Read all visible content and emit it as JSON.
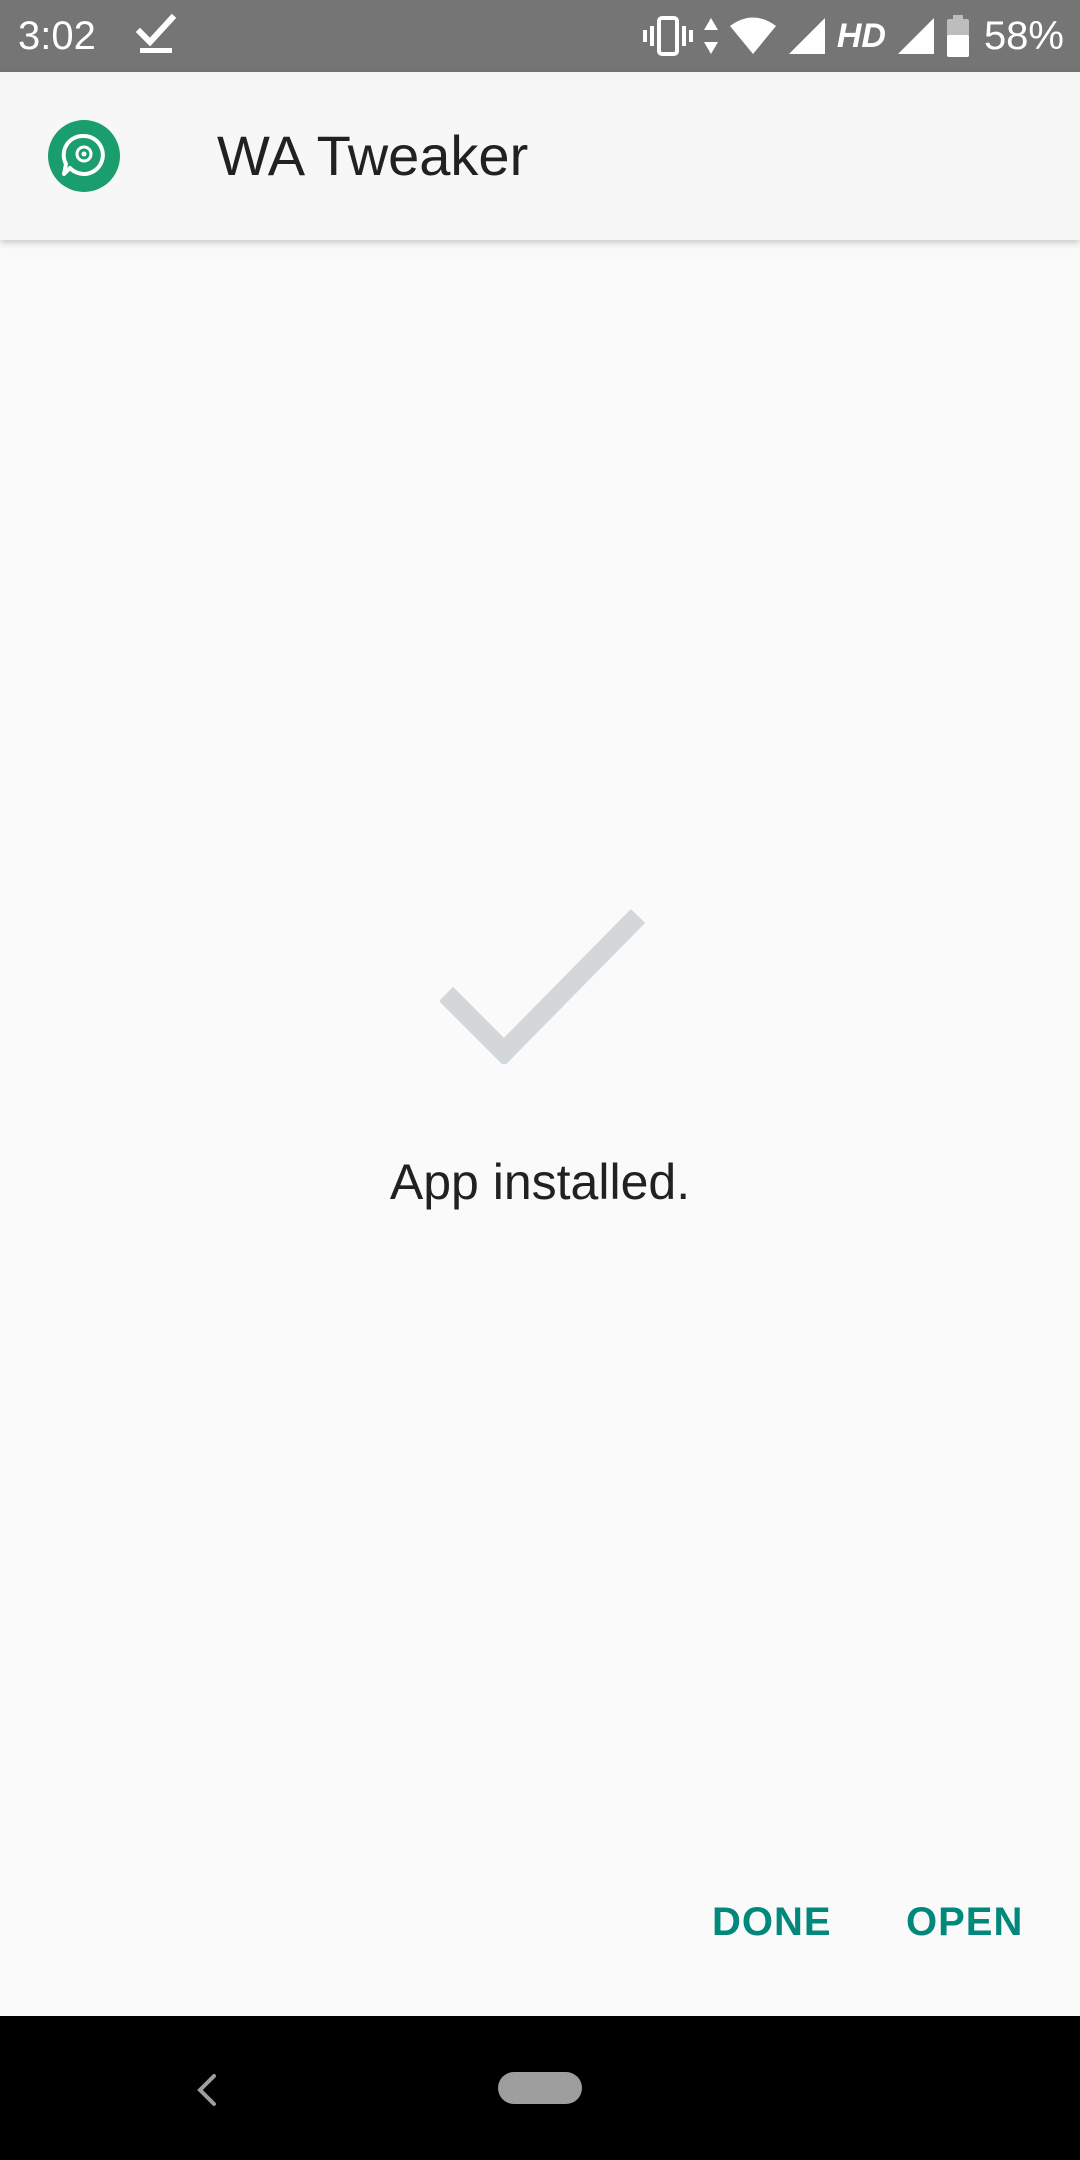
{
  "status_bar": {
    "time": "3:02",
    "network_type": "HD",
    "battery_percent": "58%",
    "icons": [
      "download-done-icon",
      "vibrate-icon",
      "data-arrows-icon",
      "wifi-icon",
      "signal-icon",
      "signal-icon",
      "battery-icon"
    ]
  },
  "app_bar": {
    "title": "WA Tweaker",
    "icon": "wa-tweaker-app-icon",
    "icon_color": "#1b9e6e"
  },
  "content": {
    "status_icon": "check-icon",
    "message": "App installed."
  },
  "actions": {
    "done_label": "DONE",
    "open_label": "OPEN",
    "accent_color": "#00897b"
  },
  "nav_bar": {
    "icons": [
      "back-icon",
      "home-pill-icon"
    ]
  }
}
